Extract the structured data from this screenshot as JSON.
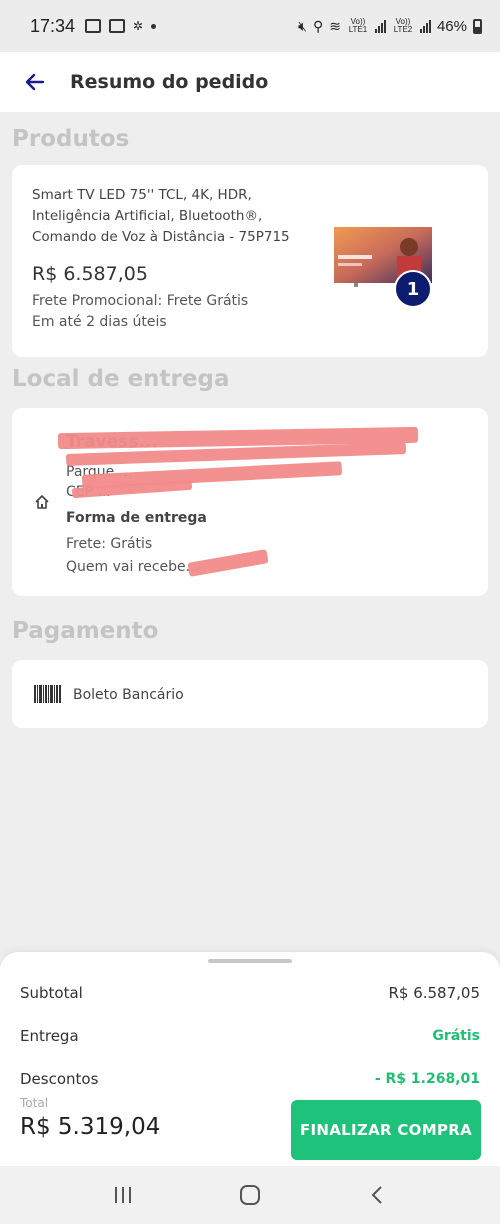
{
  "status_bar": {
    "time": "17:34",
    "network_1": "Vo)) LTE1",
    "network_2": "Vo)) LTE2",
    "battery": "46%"
  },
  "header": {
    "title": "Resumo do pedido",
    "back_icon": "arrow-left-icon"
  },
  "products": {
    "section_title": "Produtos",
    "item": {
      "name": "Smart TV LED 75'' TCL, 4K, HDR, Inteligência Artificial, Bluetooth®, Comando de Voz à Distância - 75P715",
      "price": "R$ 6.587,05",
      "shipping": "Frete Promocional: Frete Grátis",
      "delivery_time": "Em até 2 dias úteis",
      "quantity": "1"
    }
  },
  "delivery": {
    "section_title": "Local de entrega",
    "address_line_1": "Travess...",
    "address_line_2": "Parque ...",
    "address_line_3": "CEP ...",
    "method_label": "Forma de entrega",
    "shipping_line": "Frete: Grátis",
    "receiver_line": "Quem vai recebe..."
  },
  "payment": {
    "section_title": "Pagamento",
    "method": "Boleto Bancário"
  },
  "summary": {
    "subtotal_label": "Subtotal",
    "subtotal_value": "R$ 6.587,05",
    "delivery_label": "Entrega",
    "delivery_value": "Grátis",
    "discount_label": "Descontos",
    "discount_value": "- R$ 1.268,01",
    "total_label": "Total",
    "total_value": "R$ 5.319,04",
    "checkout_label": "FINALIZAR COMPRA"
  },
  "colors": {
    "accent_green": "#1fc27b",
    "badge_navy": "#0e1c6f",
    "back_arrow": "#1b1b8a"
  }
}
